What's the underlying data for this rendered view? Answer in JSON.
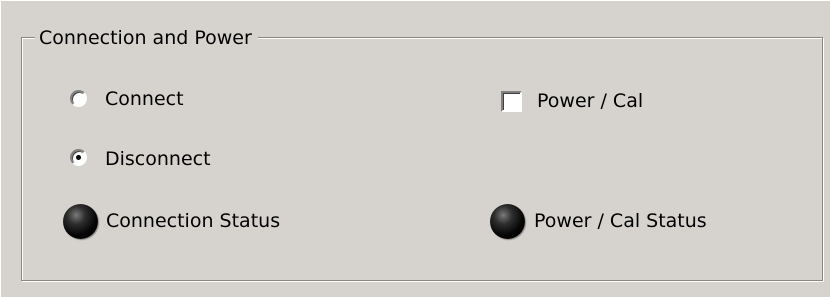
{
  "group": {
    "title": "Connection and Power"
  },
  "connection": {
    "options": [
      {
        "label": "Connect",
        "selected": false
      },
      {
        "label": "Disconnect",
        "selected": true
      }
    ],
    "status_label": "Connection Status",
    "status_icon": "led-indicator-icon"
  },
  "power": {
    "checkbox_label": "Power / Cal",
    "checked": false,
    "status_label": "Power / Cal Status",
    "status_icon": "led-indicator-icon"
  },
  "colors": {
    "background": "#d6d3ce",
    "led_off": "#000000"
  }
}
